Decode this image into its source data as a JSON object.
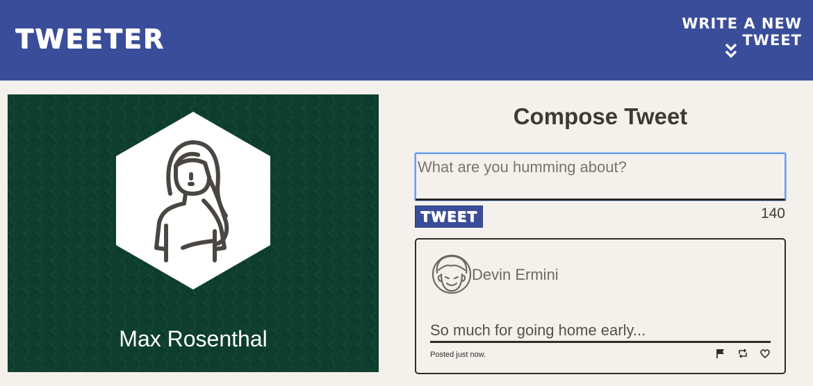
{
  "nav": {
    "brand": "TWEETER",
    "compose_toggle_label": "WRITE A NEW TWEET",
    "compose_toggle_icon": "double-chevron-down-icon"
  },
  "profile": {
    "name": "Max Rosenthal",
    "avatar_icon": "woman-avatar-icon",
    "background_color": "#0e3f2e"
  },
  "composer": {
    "title": "Compose Tweet",
    "placeholder": "What are you humming about?",
    "value": "",
    "submit_label": "TWEET",
    "counter": "140"
  },
  "tweets": [
    {
      "author": "Devin Ermini",
      "avatar_icon": "man-avatar-icon",
      "text": "So much for going home early...",
      "posted": "Posted just now.",
      "actions": [
        "flag-icon",
        "retweet-icon",
        "heart-icon"
      ]
    }
  ],
  "colors": {
    "nav_bg": "#3a4d9a",
    "page_bg": "#f4f1ec",
    "text": "#545149"
  }
}
